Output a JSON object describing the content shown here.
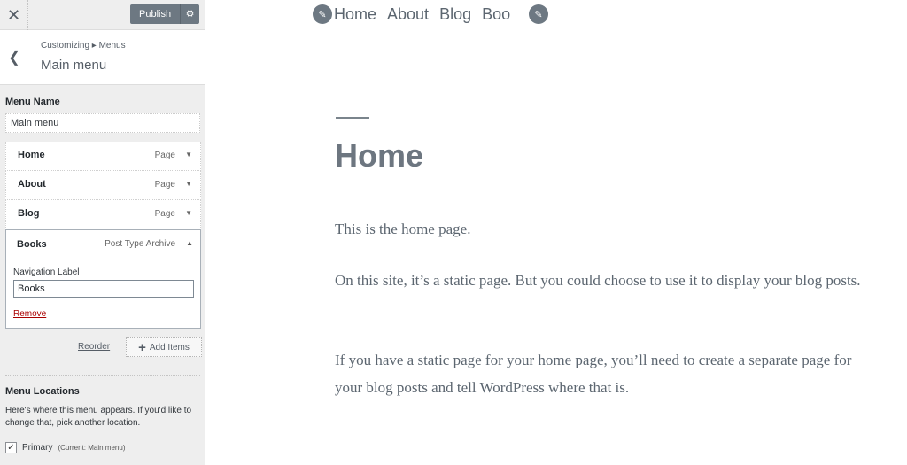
{
  "topbar": {
    "close_icon": "close-icon",
    "publish_label": "Publish",
    "publish_gear_icon": "gear-icon"
  },
  "section": {
    "breadcrumb": "Customizing ▸ Menus",
    "title": "Main menu"
  },
  "menu_name": {
    "label": "Menu Name",
    "value": "Main menu"
  },
  "menu_items": [
    {
      "title": "Home",
      "type": "Page"
    },
    {
      "title": "About",
      "type": "Page"
    },
    {
      "title": "Blog",
      "type": "Page"
    }
  ],
  "open_item": {
    "title": "Books",
    "type": "Post Type Archive",
    "nav_label_caption": "Navigation Label",
    "nav_label_value": "Books",
    "remove_label": "Remove"
  },
  "actions": {
    "reorder_label": "Reorder",
    "add_items_label": "Add Items"
  },
  "locations": {
    "title": "Menu Locations",
    "description": "Here's where this menu appears. If you'd like to change that, pick another location.",
    "primary_label": "Primary",
    "primary_current": "(Current: Main menu)",
    "primary_checked": true
  },
  "preview": {
    "nav": [
      "Home",
      "About",
      "Blog",
      "Books"
    ],
    "heading": "Home",
    "paragraphs": [
      "This is the home page.",
      "On this site, it’s a static page. But you could choose to use it to display your blog posts.",
      "If you have a static page for your home page, you’ll need to create a separate page for your blog posts and tell WordPress where that is."
    ]
  },
  "colors": {
    "publish_bg": "#6d7882",
    "sidebar_bg": "#eeeeee",
    "preview_text": "#5c6670"
  }
}
